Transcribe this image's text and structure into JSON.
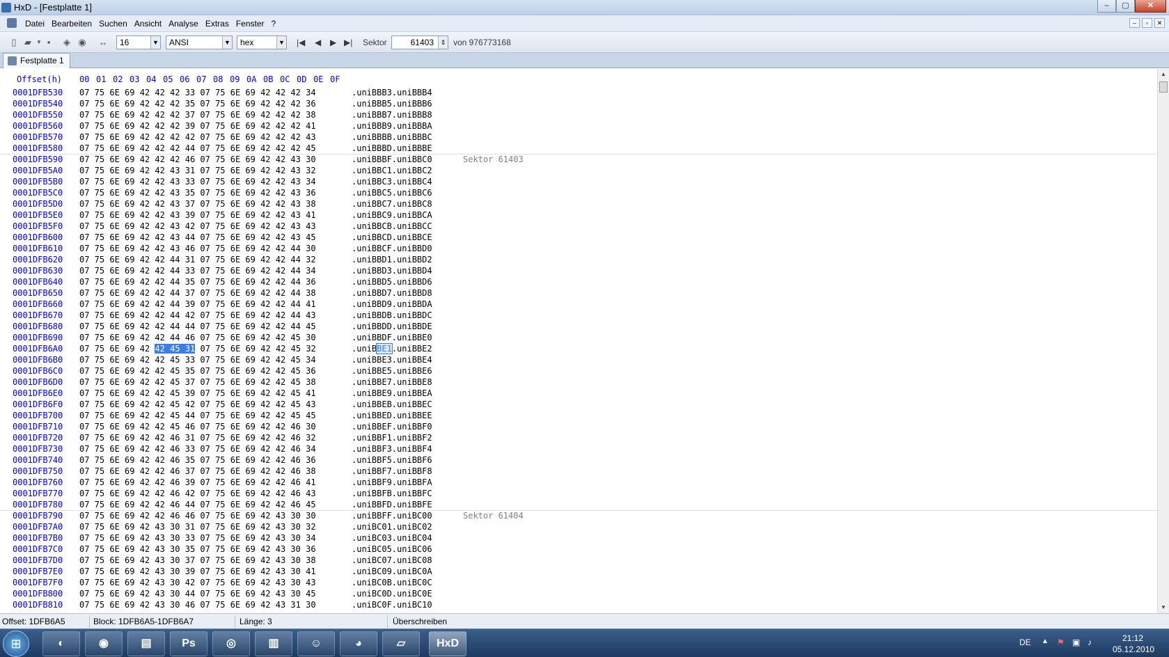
{
  "window": {
    "title": "HxD - [Festplatte 1]",
    "min": "–",
    "max": "▢",
    "close": "✕"
  },
  "menu": [
    "Datei",
    "Bearbeiten",
    "Suchen",
    "Ansicht",
    "Analyse",
    "Extras",
    "Fenster",
    "?"
  ],
  "mdi": [
    "–",
    "▫",
    "✕"
  ],
  "toolbar": {
    "bytes_per_row": "16",
    "charset": "ANSI",
    "offset_base": "hex",
    "sector_label": "Sektor",
    "sector_value": "61403",
    "sector_total": "von 976773168",
    "nav": [
      "|◀",
      "◀",
      "▶",
      "▶|"
    ]
  },
  "tab": {
    "label": "Festplatte 1"
  },
  "editor": {
    "header_offset": "Offset(h)",
    "header_cols": [
      "00",
      "01",
      "02",
      "03",
      "04",
      "05",
      "06",
      "07",
      "08",
      "09",
      "0A",
      "0B",
      "0C",
      "0D",
      "0E",
      "0F"
    ],
    "sector_labels": [
      {
        "after_row": 5,
        "text": "Sektor 61403"
      },
      {
        "after_row": 37,
        "text": "Sektor 61404"
      }
    ],
    "selection": {
      "row": 23,
      "bytes": [
        5,
        6,
        7
      ],
      "text_start": 5,
      "text_len": 3
    },
    "rows": [
      [
        "0001DFB530",
        "07 75 6E 69 42 42 42 33 07 75 6E 69 42 42 42 34",
        ".uniBBB3.uniBBB4"
      ],
      [
        "0001DFB540",
        "07 75 6E 69 42 42 42 35 07 75 6E 69 42 42 42 36",
        ".uniBBB5.uniBBB6"
      ],
      [
        "0001DFB550",
        "07 75 6E 69 42 42 42 37 07 75 6E 69 42 42 42 38",
        ".uniBBB7.uniBBB8"
      ],
      [
        "0001DFB560",
        "07 75 6E 69 42 42 42 39 07 75 6E 69 42 42 42 41",
        ".uniBBB9.uniBBBA"
      ],
      [
        "0001DFB570",
        "07 75 6E 69 42 42 42 42 07 75 6E 69 42 42 42 43",
        ".uniBBBB.uniBBBC"
      ],
      [
        "0001DFB580",
        "07 75 6E 69 42 42 42 44 07 75 6E 69 42 42 42 45",
        ".uniBBBD.uniBBBE"
      ],
      [
        "0001DFB590",
        "07 75 6E 69 42 42 42 46 07 75 6E 69 42 42 43 30",
        ".uniBBBF.uniBBC0"
      ],
      [
        "0001DFB5A0",
        "07 75 6E 69 42 42 43 31 07 75 6E 69 42 42 43 32",
        ".uniBBC1.uniBBC2"
      ],
      [
        "0001DFB5B0",
        "07 75 6E 69 42 42 43 33 07 75 6E 69 42 42 43 34",
        ".uniBBC3.uniBBC4"
      ],
      [
        "0001DFB5C0",
        "07 75 6E 69 42 42 43 35 07 75 6E 69 42 42 43 36",
        ".uniBBC5.uniBBC6"
      ],
      [
        "0001DFB5D0",
        "07 75 6E 69 42 42 43 37 07 75 6E 69 42 42 43 38",
        ".uniBBC7.uniBBC8"
      ],
      [
        "0001DFB5E0",
        "07 75 6E 69 42 42 43 39 07 75 6E 69 42 42 43 41",
        ".uniBBC9.uniBBCA"
      ],
      [
        "0001DFB5F0",
        "07 75 6E 69 42 42 43 42 07 75 6E 69 42 42 43 43",
        ".uniBBCB.uniBBCC"
      ],
      [
        "0001DFB600",
        "07 75 6E 69 42 42 43 44 07 75 6E 69 42 42 43 45",
        ".uniBBCD.uniBBCE"
      ],
      [
        "0001DFB610",
        "07 75 6E 69 42 42 43 46 07 75 6E 69 42 42 44 30",
        ".uniBBCF.uniBBD0"
      ],
      [
        "0001DFB620",
        "07 75 6E 69 42 42 44 31 07 75 6E 69 42 42 44 32",
        ".uniBBD1.uniBBD2"
      ],
      [
        "0001DFB630",
        "07 75 6E 69 42 42 44 33 07 75 6E 69 42 42 44 34",
        ".uniBBD3.uniBBD4"
      ],
      [
        "0001DFB640",
        "07 75 6E 69 42 42 44 35 07 75 6E 69 42 42 44 36",
        ".uniBBD5.uniBBD6"
      ],
      [
        "0001DFB650",
        "07 75 6E 69 42 42 44 37 07 75 6E 69 42 42 44 38",
        ".uniBBD7.uniBBD8"
      ],
      [
        "0001DFB660",
        "07 75 6E 69 42 42 44 39 07 75 6E 69 42 42 44 41",
        ".uniBBD9.uniBBDA"
      ],
      [
        "0001DFB670",
        "07 75 6E 69 42 42 44 42 07 75 6E 69 42 42 44 43",
        ".uniBBDB.uniBBDC"
      ],
      [
        "0001DFB680",
        "07 75 6E 69 42 42 44 44 07 75 6E 69 42 42 44 45",
        ".uniBBDD.uniBBDE"
      ],
      [
        "0001DFB690",
        "07 75 6E 69 42 42 44 46 07 75 6E 69 42 42 45 30",
        ".uniBBDF.uniBBE0"
      ],
      [
        "0001DFB6A0",
        "07 75 6E 69 42 42 45 31 07 75 6E 69 42 42 45 32",
        ".uniBBE1.uniBBE2"
      ],
      [
        "0001DFB6B0",
        "07 75 6E 69 42 42 45 33 07 75 6E 69 42 42 45 34",
        ".uniBBE3.uniBBE4"
      ],
      [
        "0001DFB6C0",
        "07 75 6E 69 42 42 45 35 07 75 6E 69 42 42 45 36",
        ".uniBBE5.uniBBE6"
      ],
      [
        "0001DFB6D0",
        "07 75 6E 69 42 42 45 37 07 75 6E 69 42 42 45 38",
        ".uniBBE7.uniBBE8"
      ],
      [
        "0001DFB6E0",
        "07 75 6E 69 42 42 45 39 07 75 6E 69 42 42 45 41",
        ".uniBBE9.uniBBEA"
      ],
      [
        "0001DFB6F0",
        "07 75 6E 69 42 42 45 42 07 75 6E 69 42 42 45 43",
        ".uniBBEB.uniBBEC"
      ],
      [
        "0001DFB700",
        "07 75 6E 69 42 42 45 44 07 75 6E 69 42 42 45 45",
        ".uniBBED.uniBBEE"
      ],
      [
        "0001DFB710",
        "07 75 6E 69 42 42 45 46 07 75 6E 69 42 42 46 30",
        ".uniBBEF.uniBBF0"
      ],
      [
        "0001DFB720",
        "07 75 6E 69 42 42 46 31 07 75 6E 69 42 42 46 32",
        ".uniBBF1.uniBBF2"
      ],
      [
        "0001DFB730",
        "07 75 6E 69 42 42 46 33 07 75 6E 69 42 42 46 34",
        ".uniBBF3.uniBBF4"
      ],
      [
        "0001DFB740",
        "07 75 6E 69 42 42 46 35 07 75 6E 69 42 42 46 36",
        ".uniBBF5.uniBBF6"
      ],
      [
        "0001DFB750",
        "07 75 6E 69 42 42 46 37 07 75 6E 69 42 42 46 38",
        ".uniBBF7.uniBBF8"
      ],
      [
        "0001DFB760",
        "07 75 6E 69 42 42 46 39 07 75 6E 69 42 42 46 41",
        ".uniBBF9.uniBBFA"
      ],
      [
        "0001DFB770",
        "07 75 6E 69 42 42 46 42 07 75 6E 69 42 42 46 43",
        ".uniBBFB.uniBBFC"
      ],
      [
        "0001DFB780",
        "07 75 6E 69 42 42 46 44 07 75 6E 69 42 42 46 45",
        ".uniBBFD.uniBBFE"
      ],
      [
        "0001DFB790",
        "07 75 6E 69 42 42 46 46 07 75 6E 69 42 43 30 30",
        ".uniBBFF.uniBC00"
      ],
      [
        "0001DFB7A0",
        "07 75 6E 69 42 43 30 31 07 75 6E 69 42 43 30 32",
        ".uniBC01.uniBC02"
      ],
      [
        "0001DFB7B0",
        "07 75 6E 69 42 43 30 33 07 75 6E 69 42 43 30 34",
        ".uniBC03.uniBC04"
      ],
      [
        "0001DFB7C0",
        "07 75 6E 69 42 43 30 35 07 75 6E 69 42 43 30 36",
        ".uniBC05.uniBC06"
      ],
      [
        "0001DFB7D0",
        "07 75 6E 69 42 43 30 37 07 75 6E 69 42 43 30 38",
        ".uniBC07.uniBC08"
      ],
      [
        "0001DFB7E0",
        "07 75 6E 69 42 43 30 39 07 75 6E 69 42 43 30 41",
        ".uniBC09.uniBC0A"
      ],
      [
        "0001DFB7F0",
        "07 75 6E 69 42 43 30 42 07 75 6E 69 42 43 30 43",
        ".uniBC0B.uniBC0C"
      ],
      [
        "0001DFB800",
        "07 75 6E 69 42 43 30 44 07 75 6E 69 42 43 30 45",
        ".uniBC0D.uniBC0E"
      ],
      [
        "0001DFB810",
        "07 75 6E 69 42 43 30 46 07 75 6E 69 42 43 31 30",
        ".uniBC0F.uniBC10"
      ]
    ]
  },
  "status": {
    "offset": "Offset: 1DFB6A5",
    "block": "Block: 1DFB6A5-1DFB6A7",
    "length": "Länge: 3",
    "mode": "Überschreiben"
  },
  "taskbar": {
    "apps": [
      "Ps",
      "HxD"
    ],
    "lang": "DE",
    "time": "21:12",
    "date": "05.12.2010"
  }
}
